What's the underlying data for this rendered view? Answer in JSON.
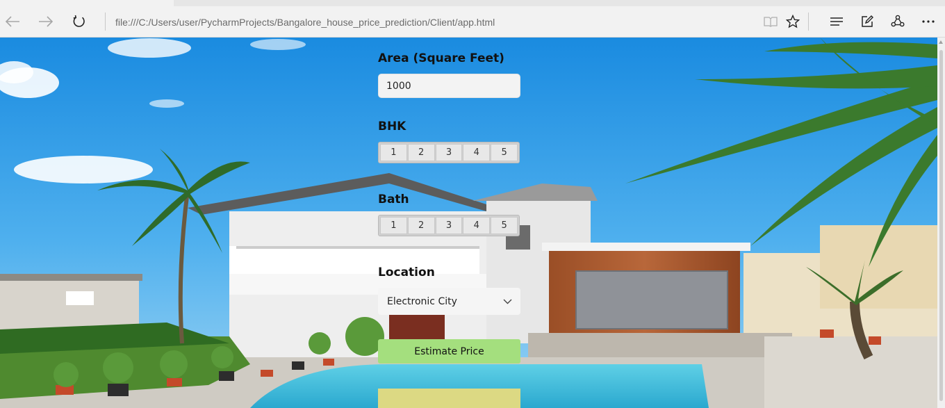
{
  "browser": {
    "url": "file:///C:/Users/user/PycharmProjects/Bangalore_house_price_prediction/Client/app.html",
    "toolbar_icons": [
      "back-icon",
      "forward-icon",
      "refresh-icon",
      "reading-view-icon",
      "favorite-star-icon",
      "hub-icon",
      "web-note-icon",
      "share-icon",
      "more-icon"
    ]
  },
  "form": {
    "area": {
      "label": "Area (Square Feet)",
      "value": "1000"
    },
    "bhk": {
      "label": "BHK",
      "options": [
        "1",
        "2",
        "3",
        "4",
        "5"
      ]
    },
    "bath": {
      "label": "Bath",
      "options": [
        "1",
        "2",
        "3",
        "4",
        "5"
      ]
    },
    "location": {
      "label": "Location",
      "selected": "Electronic City"
    },
    "estimate_button": "Estimate Price",
    "result": ""
  },
  "colors": {
    "sky": "#2a9ae6",
    "estimate_button": "#a4df7e",
    "result_box": "#dcd983"
  }
}
